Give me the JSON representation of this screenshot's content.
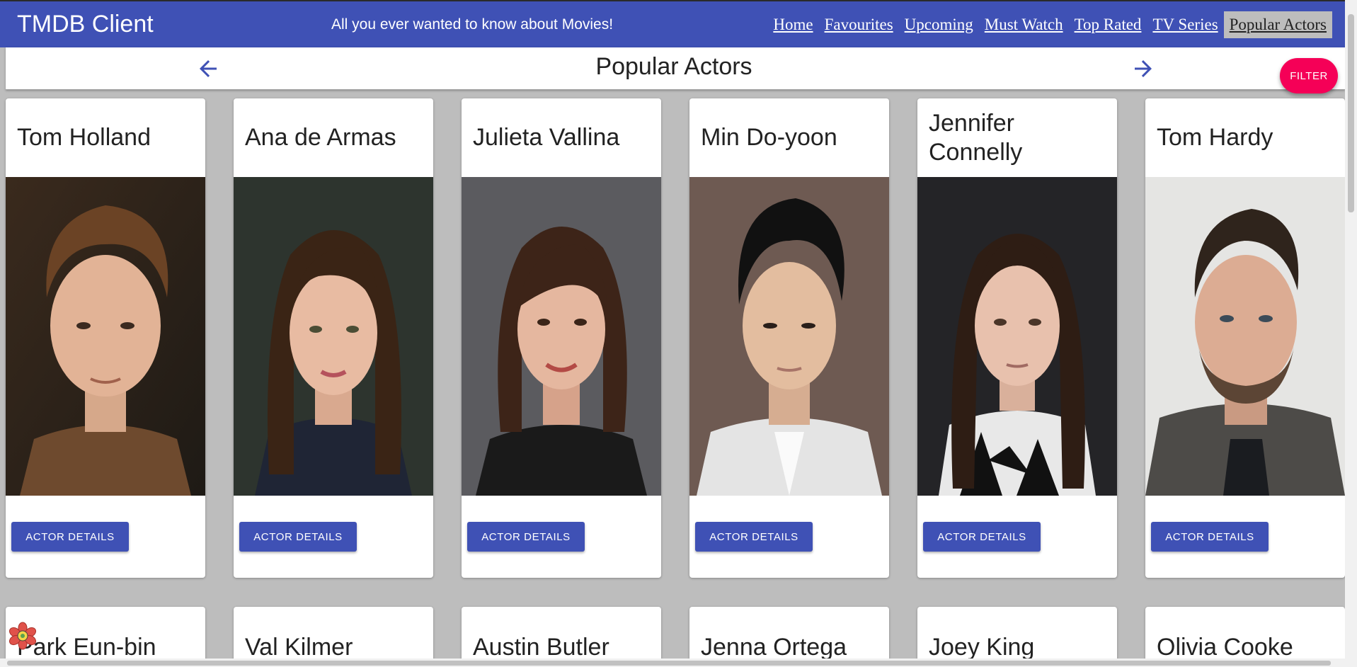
{
  "app": {
    "title": "TMDB Client",
    "tagline": "All you ever wanted to know about Movies!",
    "nav": [
      "Home",
      "Favourites",
      "Upcoming",
      "Must Watch",
      "Top Rated",
      "TV Series",
      "Popular Actors"
    ],
    "active_nav": "Popular Actors"
  },
  "page": {
    "title": "Popular Actors",
    "filter_label": "FILTER"
  },
  "actors_row1": [
    {
      "name": "Tom Holland",
      "button": "ACTOR DETAILS"
    },
    {
      "name": "Ana de Armas",
      "button": "ACTOR DETAILS"
    },
    {
      "name": "Julieta Vallina",
      "button": "ACTOR DETAILS"
    },
    {
      "name": "Min Do-yoon",
      "button": "ACTOR DETAILS"
    },
    {
      "name": "Jennifer Connelly",
      "button": "ACTOR DETAILS"
    },
    {
      "name": "Tom Hardy",
      "button": "ACTOR DETAILS"
    }
  ],
  "actors_row2": [
    {
      "name": "Park Eun-bin"
    },
    {
      "name": "Val Kilmer"
    },
    {
      "name": "Austin Butler"
    },
    {
      "name": "Jenna Ortega"
    },
    {
      "name": "Joey King"
    },
    {
      "name": "Olivia Cooke"
    }
  ],
  "colors": {
    "primary": "#3f51b5",
    "accent": "#f50057",
    "background": "#bdbdbd"
  }
}
